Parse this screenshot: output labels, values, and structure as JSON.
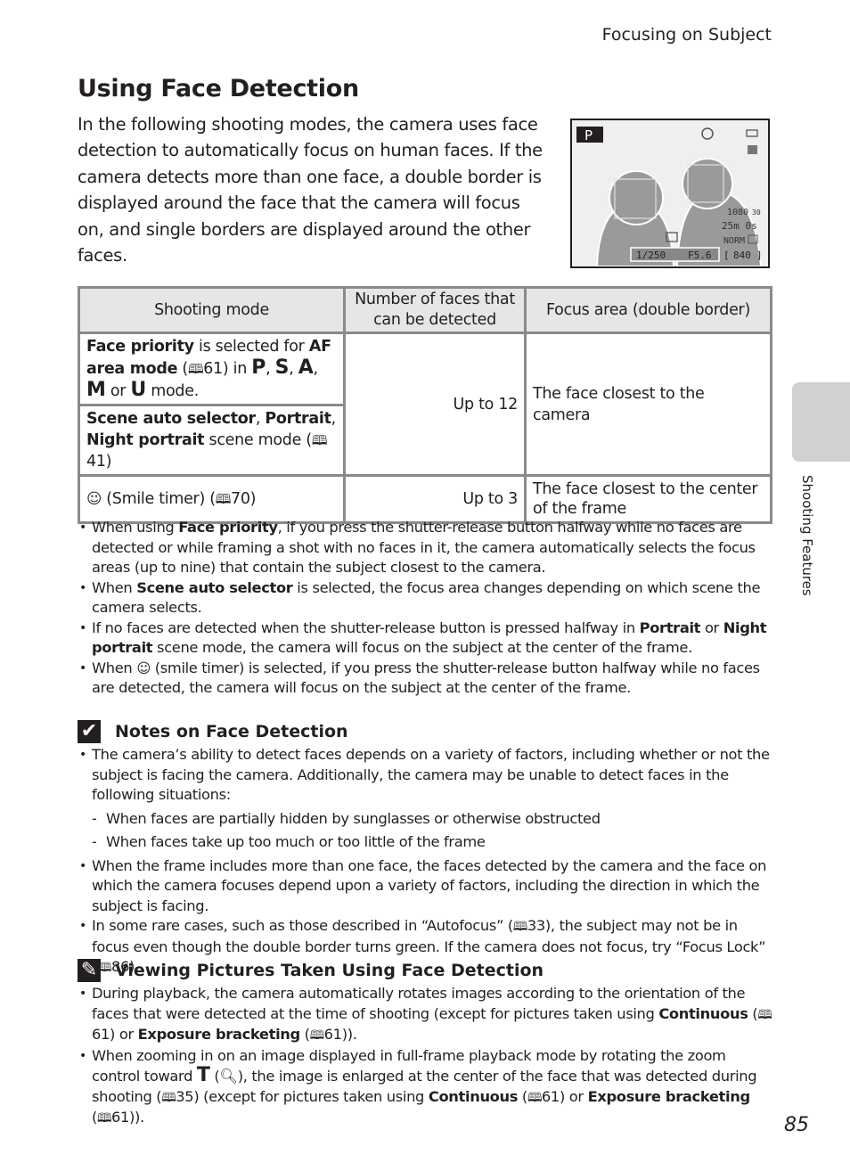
{
  "header": {
    "section": "Focusing on Subject"
  },
  "page": {
    "title": "Using Face Detection",
    "intro": "In the following shooting modes, the camera uses face detection to automatically focus on human faces. If the camera detects more than one face, a double border is displayed around the face that the camera will focus on, and single borders are displayed around the other faces.",
    "number": "85"
  },
  "camera_screen": {
    "mode": "P",
    "shutter": "1/250",
    "aperture": "F5.6",
    "video_res": "1080",
    "video_fps": "30",
    "rec_time": "25m 0s",
    "quality": "NORM",
    "exposures": "840",
    "icons": [
      "flash-auto-icon",
      "battery-icon",
      "vibration-reduction-icon",
      "face-priority-icon",
      "image-size-icon"
    ]
  },
  "table": {
    "headers": [
      "Shooting mode",
      "Number of faces that can be detected",
      "Focus area (double border)"
    ],
    "row1": {
      "b1": "Face priority",
      "t1": " is selected for ",
      "b2": "AF area mode",
      "t2": " (",
      "ref": "61",
      "t3": ") in ",
      "m1": "P",
      "m2": "S",
      "m3": "A",
      "m4": "M",
      "t4": " or ",
      "m5": "U",
      "t5": " mode."
    },
    "row2": {
      "b1": "Scene auto selector",
      "b2": "Portrait",
      "b3": "Night portrait",
      "t1": " scene mode",
      "ref": "41"
    },
    "row12_count": "Up to 12",
    "row12_focus": "The face closest to the camera",
    "row3": {
      "t1": " (Smile timer) (",
      "ref": "70",
      "count": "Up to 3",
      "focus": "The face closest to the center of the frame"
    }
  },
  "bullets": {
    "b1": {
      "t1": "When using ",
      "bold": "Face priority",
      "t2": ", if you press the shutter-release button halfway while no faces are detected or while framing a shot with no faces in it, the camera automatically selects the focus areas (up to nine) that contain the subject closest to the camera."
    },
    "b2": {
      "t1": "When ",
      "bold": "Scene auto selector",
      "t2": " is selected, the focus area changes depending on which scene the camera selects."
    },
    "b3": {
      "t1": "If no faces are detected when the shutter-release button is pressed halfway in ",
      "bold1": "Portrait",
      "t2": " or ",
      "bold2": "Night portrait",
      "t3": " scene mode, the camera will focus on the subject at the center of the frame."
    },
    "b4": {
      "t1": "When ",
      "t2": " (smile timer) is selected, if you press the shutter-release button halfway while no faces are detected, the camera will focus on the subject at the center of the frame."
    }
  },
  "notes": {
    "heading": "Notes on Face Detection",
    "n1": "The camera’s ability to detect faces depends on a variety of factors, including whether or not the subject is facing the camera. Additionally, the camera may be unable to detect faces in the following situations:",
    "d1": "When faces are partially hidden by sunglasses or otherwise obstructed",
    "d2": "When faces take up too much or too little of the frame",
    "n2": "When the frame includes more than one face, the faces detected by the camera and the face on which the camera focuses depend upon a variety of factors, including the direction in which the subject is facing.",
    "n3": {
      "t1": "In some rare cases, such as those described in “Autofocus” (",
      "ref1": "33",
      "t2": "), the subject may not be in focus even though the double border turns green. If the camera does not focus, try “Focus Lock” (",
      "ref2": "86",
      "t3": ")."
    }
  },
  "viewing": {
    "heading": "Viewing Pictures Taken Using Face Detection",
    "v1": {
      "t1": "During playback, the camera automatically rotates images according to the orientation of the faces that were detected at the time of shooting (except for pictures taken using ",
      "bold1": "Continuous",
      "t2": " (",
      "ref1": "61",
      "t3": ") or ",
      "bold2": "Exposure bracketing",
      "t4": " (",
      "ref2": "61",
      "t5": "))."
    },
    "v2": {
      "t1": "When zooming in on an image displayed in full-frame playback mode by rotating the zoom control toward ",
      "boldT": "T",
      "t2": " (",
      "t3": "), the image is enlarged at the center of the face that was detected during shooting (",
      "ref1": "35",
      "t4": ") (except for pictures taken using ",
      "bold1": "Continuous",
      "t5": " (",
      "ref2": "61",
      "t6": ") or ",
      "bold2": "Exposure bracketing",
      "t7": " (",
      "ref3": "61",
      "t8": "))."
    }
  },
  "side_tab": {
    "label": "Shooting Features"
  },
  "glyphs": {
    "book": "🕮",
    "smile": "☺",
    "magnifier": "🔍︎",
    "check": "✔",
    "clip": "✎"
  }
}
